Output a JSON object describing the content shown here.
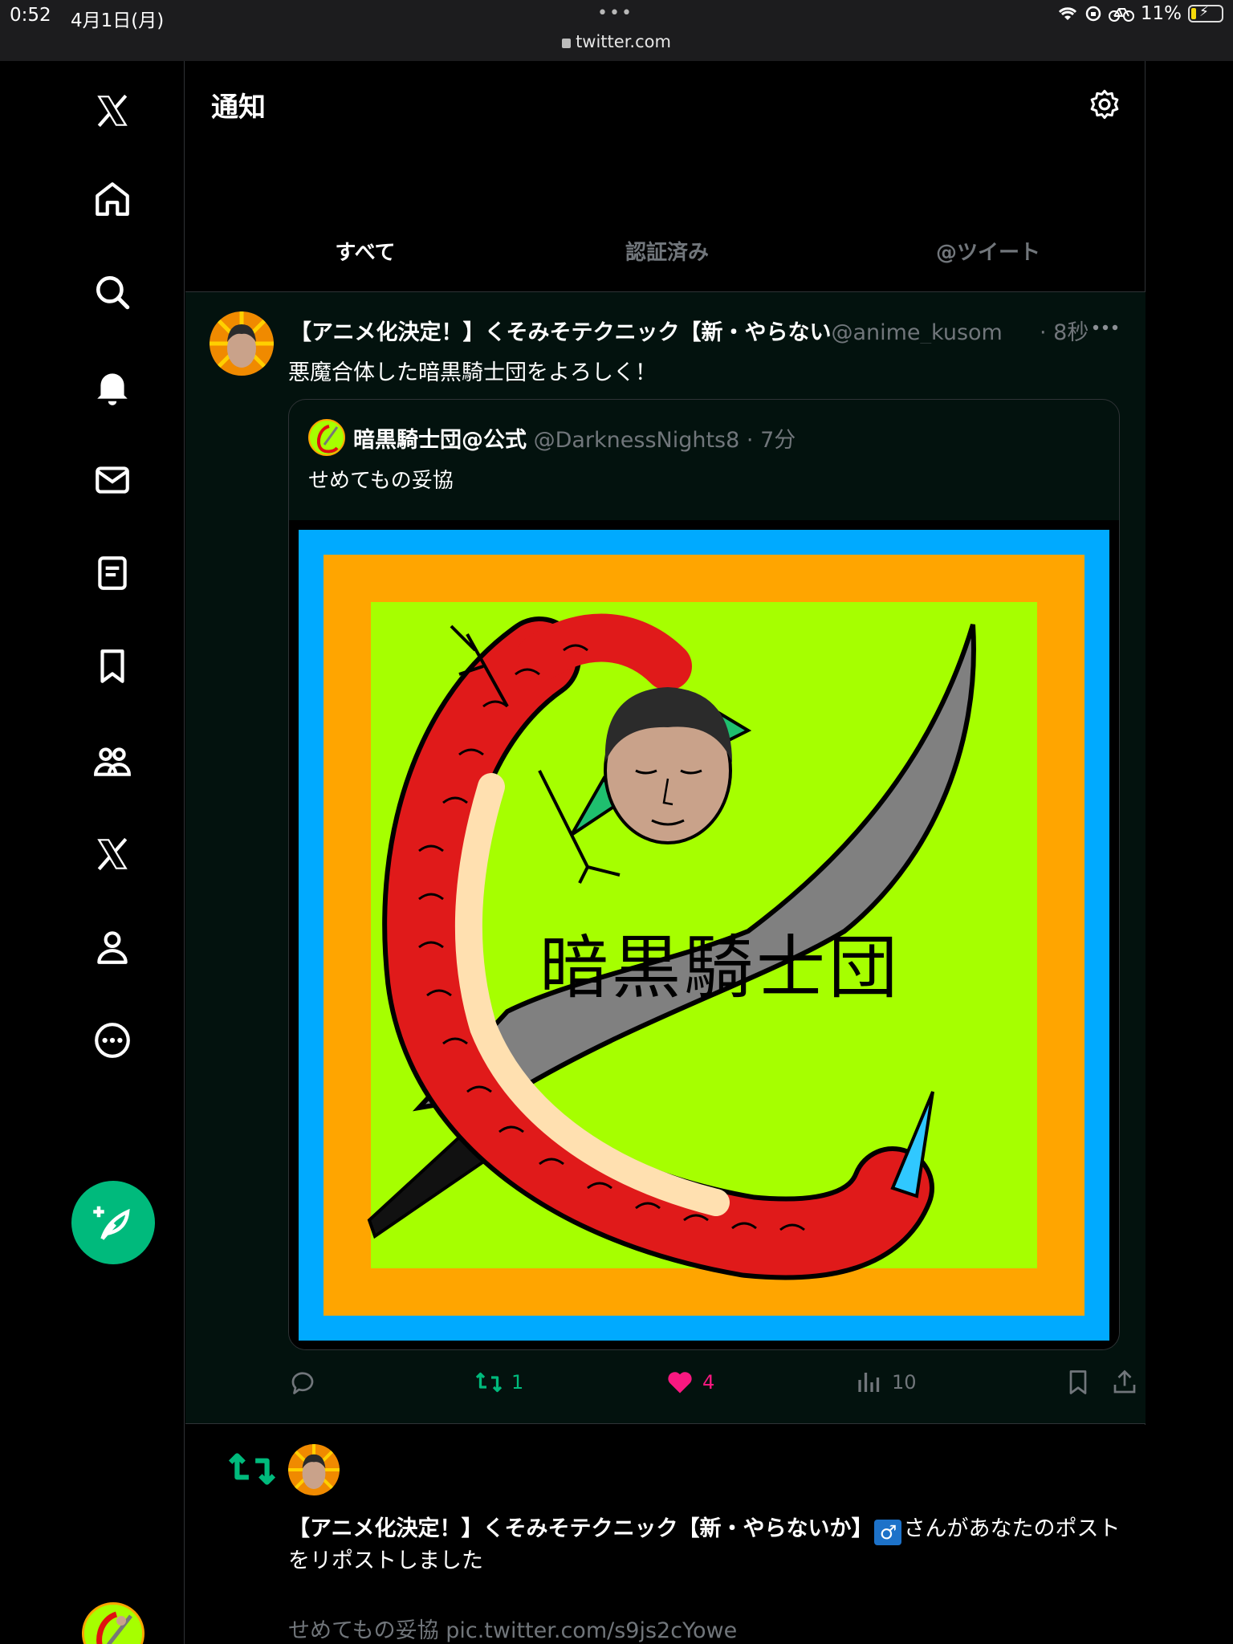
{
  "status_bar": {
    "time": "0:52",
    "date": "4月1日(月)",
    "url": "twitter.com",
    "battery": "11%"
  },
  "sidebar": {
    "items": [
      "home",
      "explore",
      "notifications",
      "messages",
      "lists",
      "bookmarks",
      "communities",
      "premium",
      "profile",
      "more"
    ]
  },
  "header": {
    "title": "通知"
  },
  "tabs": [
    {
      "label": "すべて",
      "active": true
    },
    {
      "label": "認証済み",
      "active": false
    },
    {
      "label": "@ツイート",
      "active": false
    }
  ],
  "post": {
    "author_name": "【アニメ化決定！】くそみそテクニック【新・やらない",
    "author_handle": "@anime_kusom",
    "time": "· 8秒",
    "text": "悪魔合体した暗黒騎士団をよろしく！",
    "quote": {
      "author_name": "暗黒騎士団@公式",
      "author_handle": "@DarknessNights8",
      "time": "· 7分",
      "text": "せめてもの妥協",
      "image_text": "暗黒騎士団"
    },
    "stats": {
      "retweets": "1",
      "likes": "4",
      "views": "10"
    }
  },
  "notification": {
    "name": "【アニメ化決定！】くそみそテクニック【新・やらないか】",
    "badge": "♂",
    "message": "さんがあなたのポストをリポストしました",
    "preview": "せめてもの妥協 pic.twitter.com/s9js2cYowe"
  },
  "colors": {
    "accent": "#00ba7c",
    "like": "#f91880",
    "background": "#000000",
    "post_highlight": "#03120e"
  }
}
